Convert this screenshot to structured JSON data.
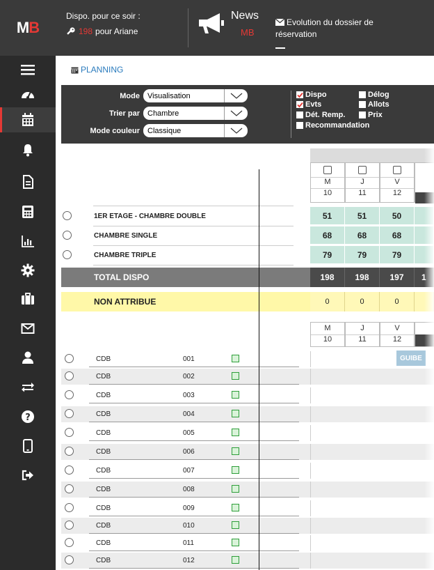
{
  "logo": {
    "m": "M",
    "b": "B"
  },
  "header": {
    "dispo_label": "Dispo. pour ce soir :",
    "dispo_count": "198",
    "dispo_suffix": "pour Ariane",
    "news_title": "News",
    "news_sub": "MB",
    "evolution_label": "Evolution du dossier de réservation"
  },
  "sidebar": {
    "items": [
      {
        "name": "menu-icon"
      },
      {
        "name": "dashboard-icon"
      },
      {
        "name": "calendar-icon",
        "active": true
      },
      {
        "name": "bell-icon"
      },
      {
        "name": "document-icon"
      },
      {
        "name": "calculator-icon"
      },
      {
        "name": "chart-icon"
      },
      {
        "name": "gear-icon"
      },
      {
        "name": "luggage-icon"
      },
      {
        "name": "mail-icon"
      },
      {
        "name": "user-icon"
      },
      {
        "name": "transfer-icon"
      },
      {
        "name": "help-icon"
      },
      {
        "name": "mobile-icon"
      },
      {
        "name": "logout-icon"
      }
    ]
  },
  "breadcrumb": {
    "label": "PLANNING"
  },
  "filters": {
    "mode_label": "Mode",
    "mode_value": "Visualisation",
    "sort_label": "Trier par",
    "sort_value": "Chambre",
    "color_label": "Mode couleur",
    "color_value": "Classique",
    "checkboxes": {
      "dispo": {
        "label": "Dispo",
        "checked": true
      },
      "delog": {
        "label": "Délog",
        "checked": false
      },
      "evts": {
        "label": "Evts",
        "checked": true
      },
      "allots": {
        "label": "Allots",
        "checked": false
      },
      "det_remp": {
        "label": "Dét. Remp.",
        "checked": false
      },
      "prix": {
        "label": "Prix",
        "checked": false
      },
      "recommandation": {
        "label": "Recommandation",
        "checked": false
      }
    }
  },
  "grid": {
    "days": [
      {
        "letter": "M",
        "date": "10"
      },
      {
        "letter": "J",
        "date": "11"
      },
      {
        "letter": "V",
        "date": "12"
      }
    ],
    "categories": [
      {
        "name": "1ER ETAGE - CHAMBRE DOUBLE",
        "values": [
          "51",
          "51",
          "50"
        ]
      },
      {
        "name": "CHAMBRE SINGLE",
        "values": [
          "68",
          "68",
          "68"
        ]
      },
      {
        "name": "CHAMBRE TRIPLE",
        "values": [
          "79",
          "79",
          "79"
        ]
      }
    ],
    "total": {
      "label": "TOTAL DISPO",
      "values": [
        "198",
        "198",
        "197",
        "1"
      ]
    },
    "non_attribue": {
      "label": "NON ATTRIBUE",
      "values": [
        "0",
        "0",
        "0"
      ]
    },
    "guibe_label": "GUIBE"
  },
  "rooms": [
    {
      "type": "CDB",
      "num": "001"
    },
    {
      "type": "CDB",
      "num": "002"
    },
    {
      "type": "CDB",
      "num": "003"
    },
    {
      "type": "CDB",
      "num": "004"
    },
    {
      "type": "CDB",
      "num": "005"
    },
    {
      "type": "CDB",
      "num": "006"
    },
    {
      "type": "CDB",
      "num": "007"
    },
    {
      "type": "CDB",
      "num": "008"
    },
    {
      "type": "CDB",
      "num": "009"
    },
    {
      "type": "CDB",
      "num": "010"
    },
    {
      "type": "CDB",
      "num": "011"
    },
    {
      "type": "CDB",
      "num": "012"
    }
  ],
  "colors": {
    "accent": "#e53935",
    "dark": "#3a3a3a",
    "green_cell": "#c9e7dd",
    "yellow_band": "#fff8a8"
  }
}
